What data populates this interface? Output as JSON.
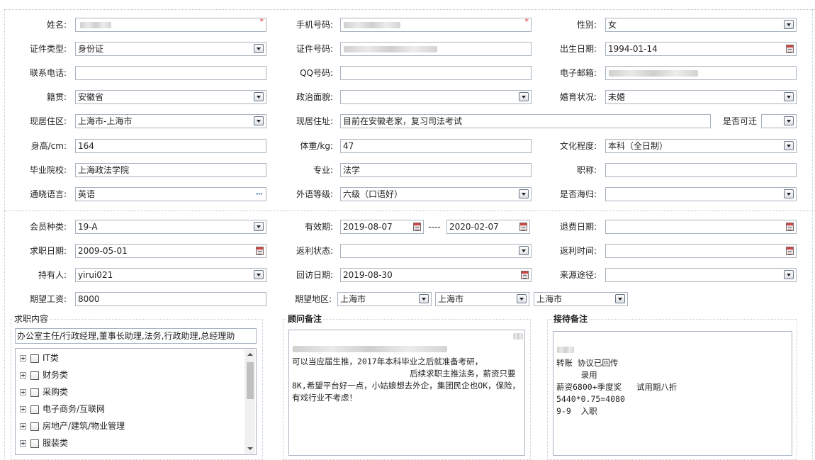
{
  "personal": {
    "name_label": "姓名:",
    "mobile_label": "手机号码:",
    "gender_label": "性别:",
    "gender_value": "女",
    "id_type_label": "证件类型:",
    "id_type_value": "身份证",
    "id_number_label": "证件号码:",
    "birth_label": "出生日期:",
    "birth_value": "1994-01-14",
    "phone_label": "联系电话:",
    "qq_label": "QQ号码:",
    "email_label": "电子邮箱:",
    "native_label": "籍贯:",
    "native_value": "安徽省",
    "political_label": "政治面貌:",
    "marital_label": "婚育状况:",
    "marital_value": "未婚",
    "residence_label": "现居住区:",
    "residence_value": "上海市-上海市",
    "address_label": "现居住址:",
    "address_value": "目前在安徽老家，复习司法考试",
    "relocate_label": "是否可迁",
    "height_label": "身高/cm:",
    "height_value": "164",
    "weight_label": "体重/kg:",
    "weight_value": "47",
    "education_label": "文化程度:",
    "education_value": "本科（全日制）",
    "school_label": "毕业院校:",
    "school_value": "上海政法学院",
    "major_label": "专业:",
    "major_value": "法学",
    "title_label": "职称:",
    "language_label": "通晓语言:",
    "language_value": "英语",
    "foreign_level_label": "外语等级:",
    "foreign_level_value": "六级（口语好）",
    "overseas_label": "是否海归:",
    "required_mark": "*",
    "more_icon": "···"
  },
  "membership": {
    "member_type_label": "会员种类:",
    "member_type_value": "19-A",
    "valid_label": "有效期:",
    "valid_from": "2019-08-07",
    "valid_sep": "----",
    "valid_to": "2020-02-07",
    "refund_date_label": "退费日期:",
    "job_date_label": "求职日期:",
    "job_date_value": "2009-05-01",
    "rebate_status_label": "返利状态:",
    "rebate_time_label": "返利时间:",
    "holder_label": "持有人:",
    "holder_value": "yirui021",
    "visit_date_label": "回访日期:",
    "visit_date_value": "2019-08-30",
    "source_label": "来源途径:",
    "salary_label": "期望工资:",
    "salary_value": "8000",
    "region_label": "期望地区:",
    "region_1": "上海市",
    "region_2": "上海市",
    "region_3": "上海市"
  },
  "job_content": {
    "title": "求职内容",
    "summary": "办公室主任/行政经理,董事长助理,法务,行政助理,总经理助",
    "categories": [
      "IT类",
      "财务类",
      "采购类",
      "电子商务/互联网",
      "房地产/建筑/物业管理",
      "服装类"
    ]
  },
  "consultant_note": {
    "title": "顾问备注",
    "text": "可以当应届生推，2017年本科毕业之后就准备考研，\n                        后续求职主推法务，薪资只要8K,希望平台好一点，小姑娘想去外企，集团民企也OK，保险，有戏行业不考虑！"
  },
  "reception_note": {
    "title": "接待备注",
    "text": "转账 协议已回传\n     录用\n薪资6800+季度奖   试用期八折\n5440*0.75=4080\n9-9  入职"
  },
  "icons": {
    "dropdown": "chevron-down-icon",
    "calendar": "calendar-icon",
    "expand": "plus-box-icon"
  }
}
